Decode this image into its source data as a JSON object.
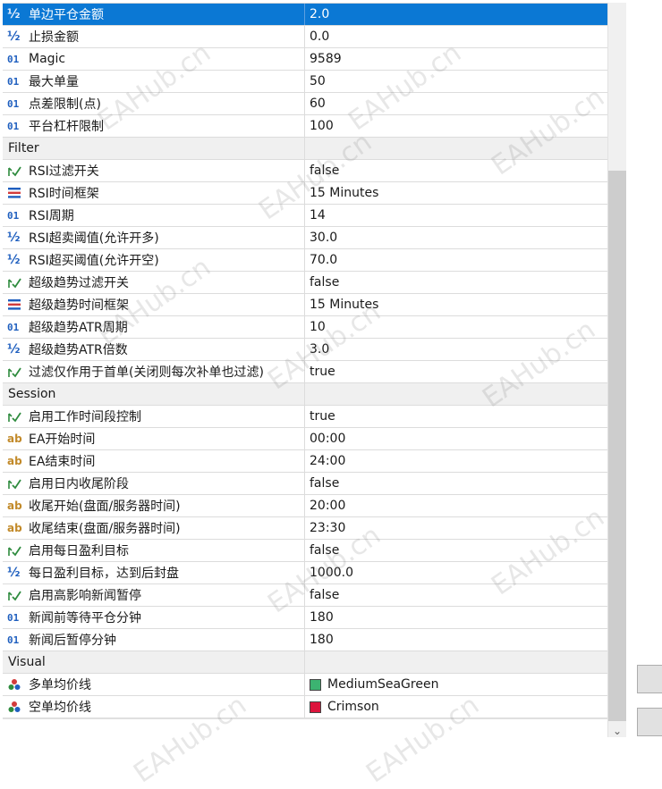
{
  "colors": {
    "selection": "#0b78d4",
    "group_bg": "#f0f0f0",
    "icon_blue": "#1f5fbf",
    "icon_green": "#2e8b3e",
    "icon_orange": "#c28a2a"
  },
  "rows": [
    {
      "type": "param",
      "icon": "double-icon",
      "label": "单边平仓金额",
      "value": "2.0",
      "selected": true
    },
    {
      "type": "param",
      "icon": "double-icon",
      "label": "止损金额",
      "value": "0.0"
    },
    {
      "type": "param",
      "icon": "integer-icon",
      "label": "Magic",
      "value": "9589"
    },
    {
      "type": "param",
      "icon": "integer-icon",
      "label": "最大单量",
      "value": "50"
    },
    {
      "type": "param",
      "icon": "integer-icon",
      "label": "点差限制(点)",
      "value": "60"
    },
    {
      "type": "param",
      "icon": "integer-icon",
      "label": "平台杠杆限制",
      "value": "100"
    },
    {
      "type": "group",
      "label": "Filter"
    },
    {
      "type": "param",
      "icon": "bool-icon",
      "label": "RSI过滤开关",
      "value": "false"
    },
    {
      "type": "param",
      "icon": "enum-icon",
      "label": "RSI时间框架",
      "value": "15 Minutes"
    },
    {
      "type": "param",
      "icon": "integer-icon",
      "label": "RSI周期",
      "value": "14"
    },
    {
      "type": "param",
      "icon": "double-icon",
      "label": "RSI超卖阈值(允许开多)",
      "value": "30.0"
    },
    {
      "type": "param",
      "icon": "double-icon",
      "label": "RSI超买阈值(允许开空)",
      "value": "70.0"
    },
    {
      "type": "param",
      "icon": "bool-icon",
      "label": "超级趋势过滤开关",
      "value": "false"
    },
    {
      "type": "param",
      "icon": "enum-icon",
      "label": "超级趋势时间框架",
      "value": "15 Minutes"
    },
    {
      "type": "param",
      "icon": "integer-icon",
      "label": "超级趋势ATR周期",
      "value": "10"
    },
    {
      "type": "param",
      "icon": "double-icon",
      "label": "超级趋势ATR倍数",
      "value": "3.0"
    },
    {
      "type": "param",
      "icon": "bool-icon",
      "label": "过滤仅作用于首单(关闭则每次补单也过滤)",
      "value": "true"
    },
    {
      "type": "group",
      "label": "Session"
    },
    {
      "type": "param",
      "icon": "bool-icon",
      "label": "启用工作时间段控制",
      "value": "true"
    },
    {
      "type": "param",
      "icon": "string-icon",
      "label": "EA开始时间",
      "value": "00:00"
    },
    {
      "type": "param",
      "icon": "string-icon",
      "label": "EA结束时间",
      "value": "24:00"
    },
    {
      "type": "param",
      "icon": "bool-icon",
      "label": "启用日内收尾阶段",
      "value": "false"
    },
    {
      "type": "param",
      "icon": "string-icon",
      "label": "收尾开始(盘面/服务器时间)",
      "value": "20:00"
    },
    {
      "type": "param",
      "icon": "string-icon",
      "label": "收尾结束(盘面/服务器时间)",
      "value": "23:30"
    },
    {
      "type": "param",
      "icon": "bool-icon",
      "label": "启用每日盈利目标",
      "value": "false"
    },
    {
      "type": "param",
      "icon": "double-icon",
      "label": "每日盈利目标，达到后封盘",
      "value": "1000.0"
    },
    {
      "type": "param",
      "icon": "bool-icon",
      "label": "启用高影响新闻暂停",
      "value": "false"
    },
    {
      "type": "param",
      "icon": "integer-icon",
      "label": "新闻前等待平仓分钟",
      "value": "180"
    },
    {
      "type": "param",
      "icon": "integer-icon",
      "label": "新闻后暂停分钟",
      "value": "180"
    },
    {
      "type": "group",
      "label": "Visual"
    },
    {
      "type": "param",
      "icon": "color-icon",
      "label": "多单均价线",
      "value": "MediumSeaGreen",
      "swatch": "#3cb371"
    },
    {
      "type": "param",
      "icon": "color-icon",
      "label": "空单均价线",
      "value": "Crimson",
      "swatch": "#dc143c"
    }
  ],
  "icon_text": {
    "integer": "01",
    "double": "½",
    "string": "ab"
  },
  "watermark": "EAHub.cn"
}
